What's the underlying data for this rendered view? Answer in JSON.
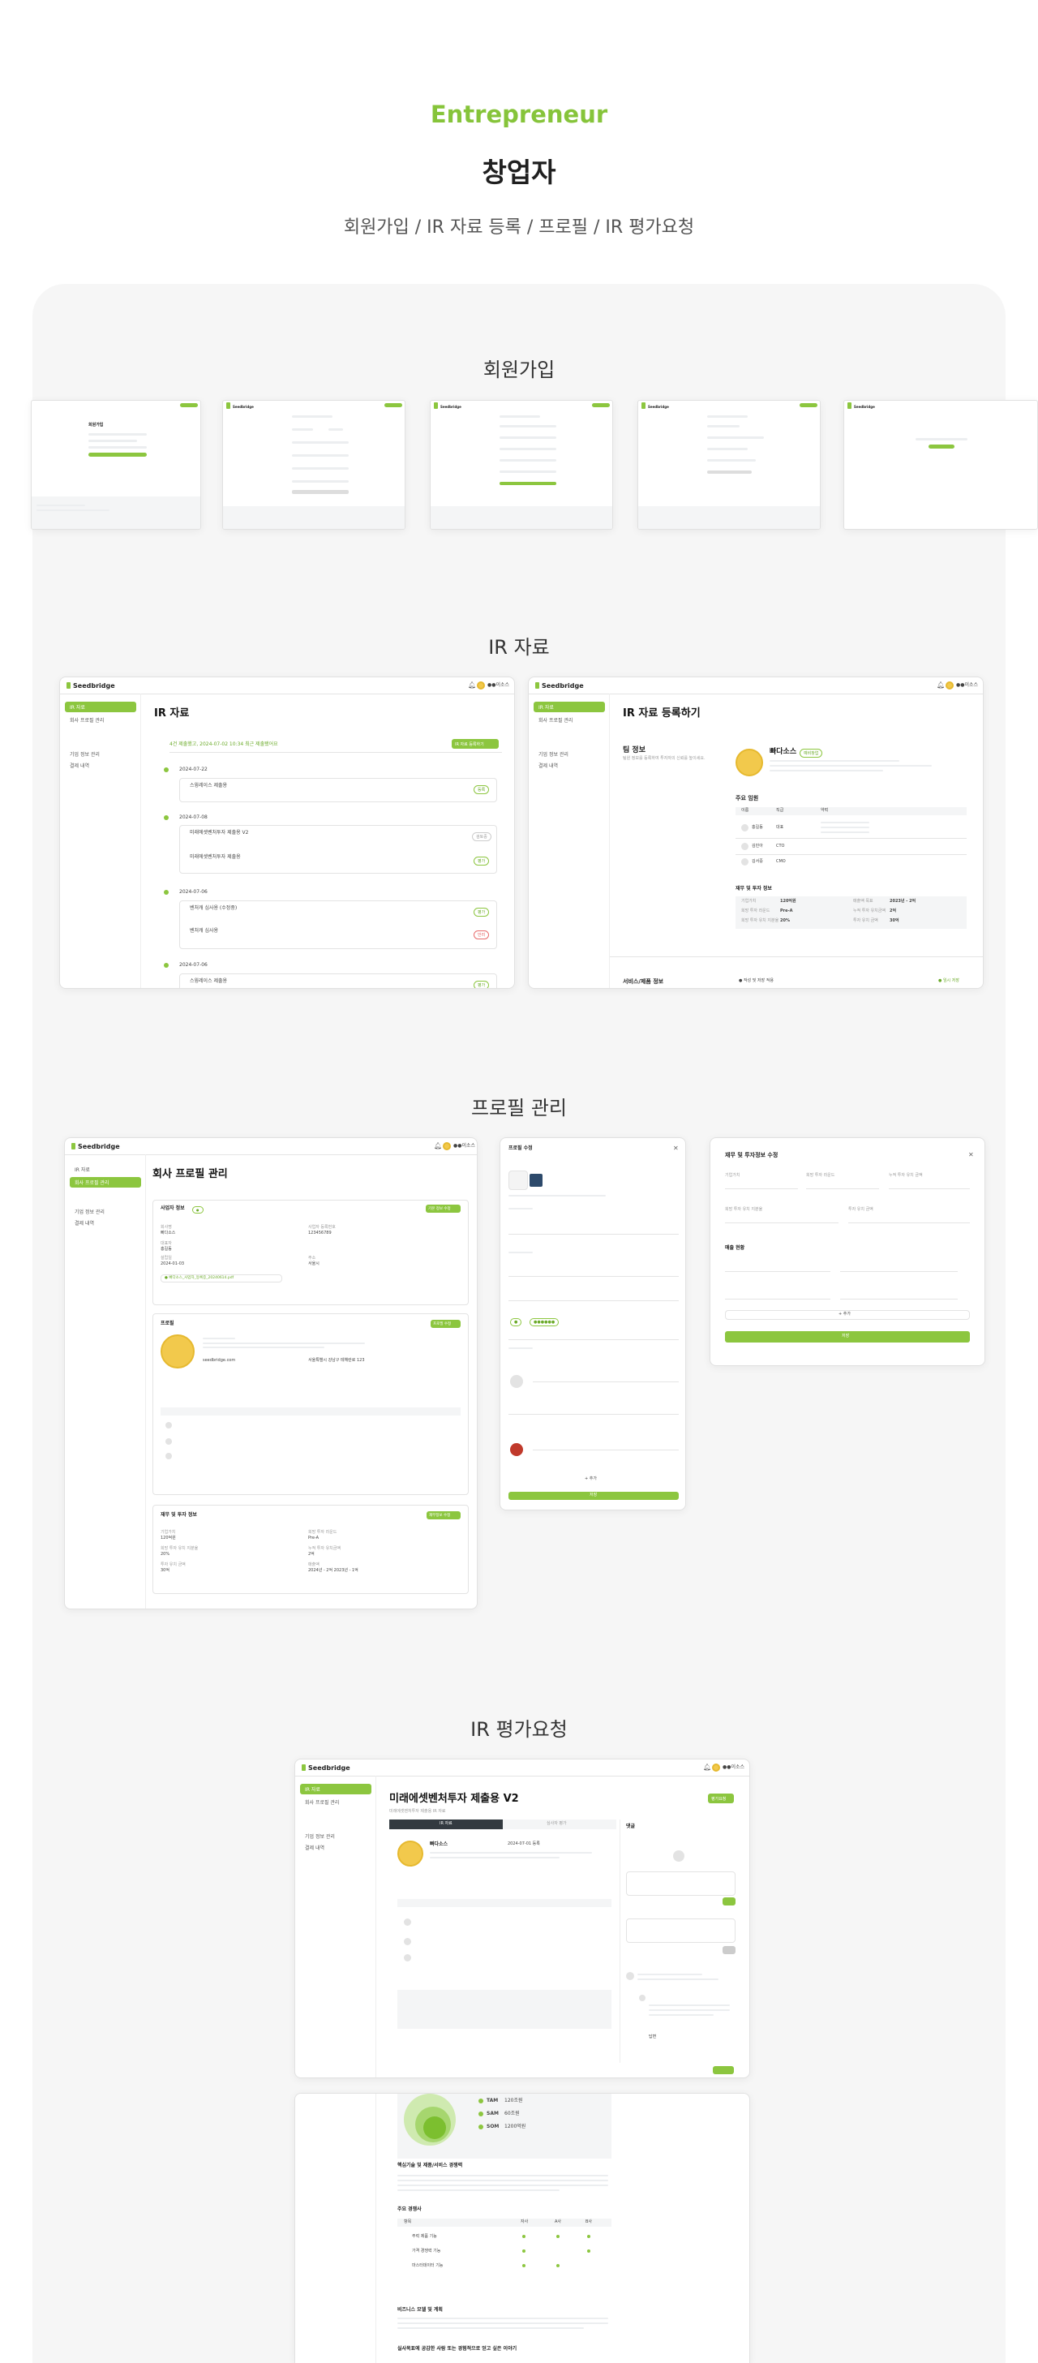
{
  "hero": {
    "eyebrow": "Entrepreneur",
    "title": "창업자",
    "subtitle": "회원가입 / IR 자료 등록 / 프로필 / IR 평가요청"
  },
  "sections": {
    "signup": "회원가입",
    "ir": "IR 자료",
    "profile": "프로필 관리",
    "eval": "IR 평가요청"
  },
  "app": {
    "logo": "Seedbridge",
    "user": "●●이소스"
  },
  "nav": {
    "ir": "IR 자료",
    "company_profile": "회사 프로필 관리",
    "org_info": "기업 정보 관리",
    "payment": "결제 내역"
  },
  "ir_list": {
    "title": "IR 자료",
    "banner": "4건 제출했고, 2024-07-02 10:34 최근 제출됐어요",
    "register_button": "IR 자료 등록하기",
    "dates": [
      "2024-07-22",
      "2024-07-08",
      "2024-07-06",
      "2024-07-06"
    ],
    "items": [
      "스윙레이스 제출용",
      "미래에셋벤처투자 제출용 V2",
      "미래에셋벤처투자 제출용",
      "벤처캐 심사용 (수정중)",
      "벤처캐 심사용",
      "스윙레이스 제출용"
    ],
    "status": [
      "등록",
      "검토중",
      "평가",
      "평가",
      "반려",
      "평가"
    ]
  },
  "ir_register": {
    "title": "IR 자료 등록하기",
    "team_info": "팀 정보",
    "team_desc": "팀원 정보를 등록하여 투자자의 신뢰를 높이세요.",
    "company": "빠다소스",
    "badge": "예비창업",
    "members_title": "주요 임원",
    "cols": [
      "이름",
      "직급",
      "약력"
    ],
    "members": [
      {
        "name": "홍길동",
        "role": "대표"
      },
      {
        "name": "김민아",
        "role": "CTO"
      },
      {
        "name": "김서중",
        "role": "CMO"
      }
    ],
    "finance_title": "재무 및 투자 정보",
    "finance": [
      {
        "k": "기업가치",
        "v": "120억원"
      },
      {
        "k": "매출액 목표",
        "v": "2023년 - 2억"
      },
      {
        "k": "희망 투자 라운드",
        "v": "Pre-A"
      },
      {
        "k": "누적 투자 유치금액",
        "v": "2억"
      },
      {
        "k": "희망 투자 유치 지분율",
        "v": "20%"
      },
      {
        "k": "투자 유치 금액",
        "v": "30억"
      }
    ],
    "service_title": "서비스/제품 정보",
    "save": "● 작성 및 저장 적용",
    "temp": "● 임시 저장"
  },
  "profile": {
    "title": "회사 프로필 관리",
    "biz_title": "사업자 정보",
    "edit": "기본 정보 수정",
    "fields": [
      {
        "k": "회사명",
        "v": "빠다소스"
      },
      {
        "k": "사업자 등록번호",
        "v": "123456789"
      },
      {
        "k": "대표자",
        "v": "홍길동"
      },
      {
        "k": "설립일",
        "v": "2024-01-03"
      },
      {
        "k": "주소",
        "v": "서울시"
      }
    ],
    "file": "● 빠다소스_사업자_등록증_20240614.pdf",
    "profile_title": "프로필",
    "profile_edit": "프로필 수정",
    "homepage": "seedbridge.com",
    "address": "서울특별시 강남구 테헤란로 123",
    "finance_title": "재무 및 투자 정보",
    "finance_edit": "재무정보 수정",
    "finance": [
      {
        "k": "기업가치",
        "v": "120억원"
      },
      {
        "k": "희망 투자 라운드",
        "v": "Pre-A"
      },
      {
        "k": "희망 투자 유치 지분율",
        "v": "20%"
      },
      {
        "k": "누적 투자 유치금액",
        "v": "2억"
      },
      {
        "k": "투자 유치 금액",
        "v": "30억"
      },
      {
        "k": "매출액",
        "v": "2024년 - 2억    2023년 - 1억"
      }
    ]
  },
  "modal_profile": {
    "title": "프로필 수정",
    "save": "저장"
  },
  "modal_finance": {
    "title": "재무 및 투자정보 수정",
    "labels": [
      "기업가치",
      "희망 투자 라운드",
      "누적 투자 유치 금액",
      "희망 투자 유치 지분율",
      "투자 유치 금액"
    ],
    "revenue_title": "매출 현황",
    "add": "+ 추가",
    "save": "저장"
  },
  "eval": {
    "title": "미래에셋벤처투자 제출용 V2",
    "sub": "미래에셋벤처투자 제출용 IR 자료",
    "tab1": "IR 자료",
    "tab2": "심사자 평가",
    "request": "평가요청",
    "company": "빠다소스",
    "date": "2024-07-01 등록",
    "comment_title": "댓글",
    "reply": "답변",
    "tab_body": [
      "핵심기술 및 제품/서비스 경쟁력",
      "주요 경쟁사",
      "비즈니스 모델 및 계획"
    ],
    "market": [
      {
        "label": "TAM",
        "v": "120조원"
      },
      {
        "label": "SAM",
        "v": "60조원"
      },
      {
        "label": "SOM",
        "v": "1200억원"
      }
    ],
    "competitors_cols": [
      "항목",
      "자사",
      "A사",
      "B사"
    ],
    "competitors_rows": [
      "주력 제품 기능",
      "가격 경쟁력 기능",
      "마스터데이터 기능"
    ],
    "last": "실사목표에 공감한 사람 또는 경험적으로 얻고 싶은 이야기"
  }
}
